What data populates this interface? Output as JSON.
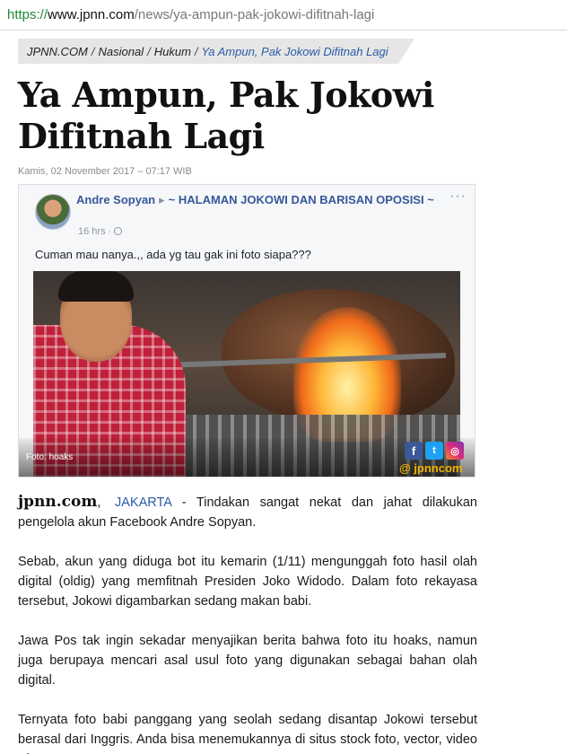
{
  "browser": {
    "url_scheme": "https://",
    "url_host": "www.jpnn.com",
    "url_path": "/news/ya-ampun-pak-jokowi-difitnah-lagi"
  },
  "breadcrumb": {
    "items": [
      "JPNN.COM",
      "Nasional",
      "Hukum"
    ],
    "separator": "/",
    "current": "Ya Ampun, Pak Jokowi Difitnah Lagi"
  },
  "article": {
    "title": "Ya Ampun, Pak Jokowi Difitnah Lagi",
    "dateline": "Kamis, 02 November 2017 – 07:17 WIB",
    "image": {
      "fb_author": "Andre Sopyan",
      "fb_arrow": "▸",
      "fb_group": "~ HALAMAN JOKOWI DAN BARISAN OPOSISI ~",
      "fb_more": "···",
      "fb_time": "16 hrs ·",
      "fb_text": "Cuman mau nanya.,, ada yg tau gak ini foto siapa???",
      "caption": "Foto: hoaks",
      "social": {
        "facebook": "f",
        "twitter": "t",
        "instagram": "◎"
      },
      "handle": "@ jpnncom"
    },
    "source": "jpnn.com",
    "source_sep": ",",
    "city": "JAKARTA",
    "lead": "- Tindakan sangat nekat dan jahat dilakukan pengelola akun Facebook Andre Sopyan.",
    "paragraphs": [
      "Sebab, akun yang diduga bot itu kemarin (1/11) mengunggah foto hasil olah digital (oldig) yang memfitnah Presiden Joko Widodo. Dalam foto rekayasa tersebut, Jokowi digambarkan sedang makan babi.",
      "Jawa Pos tak ingin sekadar menyajikan berita bahwa foto itu hoaks, namun juga berupaya mencari asal usul foto yang digunakan sebagai bahan olah digital.",
      "Ternyata foto babi panggang yang seolah sedang disantap Jokowi tersebut berasal dari Inggris. Anda bisa menemukannya di situs stock foto, vector, video Alamy.com."
    ]
  }
}
